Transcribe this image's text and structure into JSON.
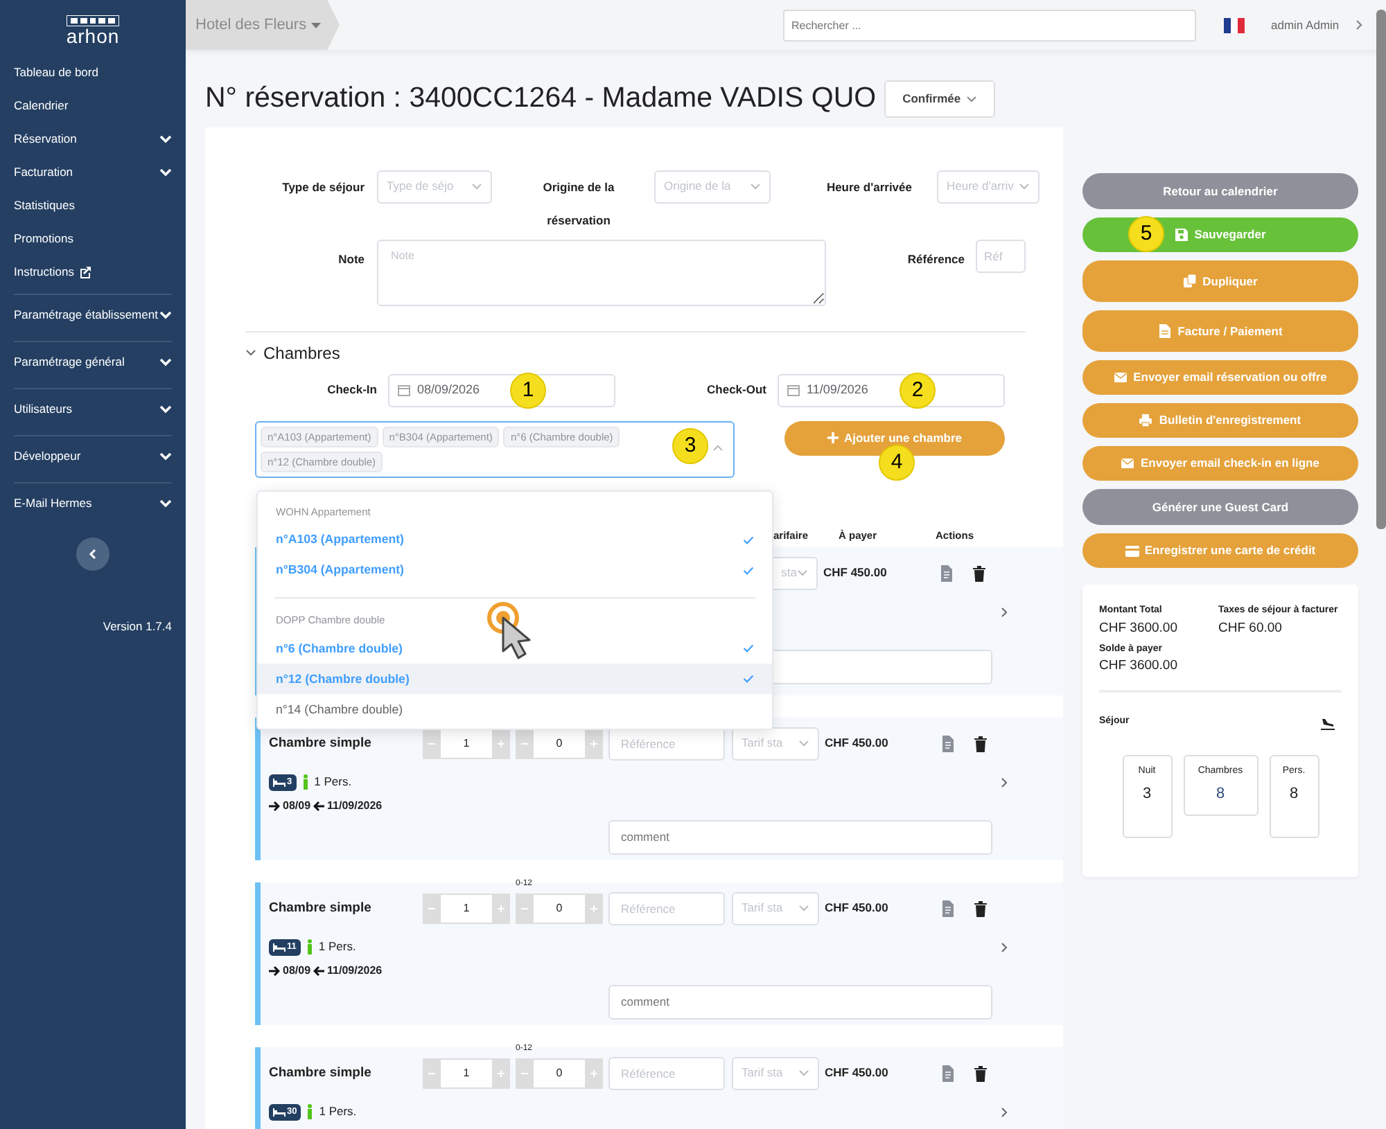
{
  "sidebar": {
    "logo": "arhon",
    "items": [
      {
        "label": "Tableau de bord",
        "kind": "link"
      },
      {
        "label": "Calendrier",
        "kind": "link"
      },
      {
        "label": "Réservation",
        "kind": "submenu"
      },
      {
        "label": "Facturation",
        "kind": "submenu"
      },
      {
        "label": "Statistiques",
        "kind": "link"
      },
      {
        "label": "Promotions",
        "kind": "link"
      },
      {
        "label": "Instructions",
        "kind": "external"
      },
      {
        "label": "Paramétrage établissement",
        "kind": "section"
      },
      {
        "label": "Paramétrage général",
        "kind": "section"
      },
      {
        "label": "Utilisateurs",
        "kind": "section"
      },
      {
        "label": "Développeur",
        "kind": "section"
      },
      {
        "label": "E-Mail Hermes",
        "kind": "section"
      }
    ],
    "version": "Version 1.7.4"
  },
  "topbar": {
    "hotel": "Hotel des Fleurs",
    "search": {
      "placeholder": "Rechercher ..."
    },
    "user": "admin Admin"
  },
  "title": "N° réservation : 3400CC1264 - Madame VADIS QUO",
  "status": "Confirmée",
  "form": {
    "stay_type": {
      "label": "Type de séjour",
      "placeholder": "Type de séjo"
    },
    "origin": {
      "label": "Origine de la réservation",
      "placeholder": "Origine de la"
    },
    "arrival": {
      "label": "Heure d'arrivée",
      "placeholder": "Heure d'arriv"
    },
    "note": {
      "label": "Note",
      "placeholder": "Note"
    },
    "reference": {
      "label": "Référence",
      "placeholder": "Réf"
    }
  },
  "rooms_section": {
    "title": "Chambres",
    "expanded": true,
    "checkin": {
      "label": "Check-In",
      "value": "08/09/2026",
      "callout": "1"
    },
    "checkout": {
      "label": "Check-Out",
      "value": "11/09/2026",
      "callout": "2"
    },
    "room_select": {
      "callout": "3",
      "tags": [
        "n°A103 (Appartement)",
        "n°B304 (Appartement)",
        "n°6 (Chambre double)",
        "n°12 (Chambre double)"
      ],
      "open": true,
      "groups": [
        {
          "title": "WOHN Appartement",
          "options": [
            {
              "label": "n°A103 (Appartement)",
              "selected": true,
              "hovered": false
            },
            {
              "label": "n°B304 (Appartement)",
              "selected": true,
              "hovered": false
            }
          ]
        },
        {
          "title": "DOPP Chambre double",
          "options": [
            {
              "label": "n°6 (Chambre double)",
              "selected": true,
              "hovered": false
            },
            {
              "label": "n°12 (Chambre double)",
              "selected": true,
              "hovered": true
            },
            {
              "label": "n°14 (Chambre double)",
              "selected": false,
              "hovered": false
            }
          ]
        }
      ]
    },
    "add_button": {
      "label": "Ajouter une chambre",
      "callout": "4"
    },
    "columns": [
      "arifaire",
      "À payer",
      "Actions"
    ],
    "rooms": [
      {
        "kind": "partial",
        "tarif": "sta",
        "price": "CHF 450.00"
      },
      {
        "kind": "full",
        "name": "Chambre simple",
        "adults": "1",
        "children": "0",
        "reference_placeholder": "Référence",
        "tarif": "Tarif sta",
        "price": "CHF 450.00",
        "room_number": "3",
        "persons": "1 Pers.",
        "arrival": "08/09",
        "departure": "11/09/2026",
        "comment_placeholder": "comment"
      },
      {
        "kind": "full",
        "name": "Chambre simple",
        "age_range": "0-12",
        "adults": "1",
        "children": "0",
        "reference_placeholder": "Référence",
        "tarif": "Tarif sta",
        "price": "CHF 450.00",
        "room_number": "11",
        "persons": "1 Pers.",
        "arrival": "08/09",
        "departure": "11/09/2026",
        "comment_placeholder": "comment"
      },
      {
        "kind": "cut",
        "name": "Chambre simple",
        "age_range": "0-12",
        "adults": "1",
        "children": "0",
        "reference_placeholder": "Référence",
        "tarif": "Tarif sta",
        "price": "CHF 450.00",
        "room_number": "30",
        "persons": "1 Pers."
      }
    ]
  },
  "actions": [
    {
      "label": "Retour au calendrier",
      "kind": "secondary"
    },
    {
      "label": "Sauvegarder",
      "kind": "success",
      "callout": "5"
    },
    {
      "label": "Dupliquer",
      "kind": "warning"
    },
    {
      "label": "Facture / Paiement",
      "kind": "warning"
    },
    {
      "label": "Envoyer email réservation ou offre",
      "kind": "warning"
    },
    {
      "label": "Bulletin d'enregistrement",
      "kind": "warning"
    },
    {
      "label": "Envoyer email check-in en ligne",
      "kind": "warning"
    },
    {
      "label": "Générer une Guest Card",
      "kind": "secondary"
    },
    {
      "label": "Enregistrer une carte de crédit",
      "kind": "warning"
    }
  ],
  "summary": {
    "total_label": "Montant Total",
    "total": "CHF 3600.00",
    "tax_label": "Taxes de séjour à facturer",
    "tax": "CHF 60.00",
    "balance_label": "Solde à payer",
    "balance": "CHF 3600.00",
    "stay_label": "Séjour",
    "stats": [
      {
        "label": "Nuit",
        "value": "3",
        "kind": "plain"
      },
      {
        "label": "Chambres",
        "value": "8",
        "kind": "accent"
      },
      {
        "label": "Pers.",
        "value": "8",
        "kind": "plain"
      }
    ]
  }
}
